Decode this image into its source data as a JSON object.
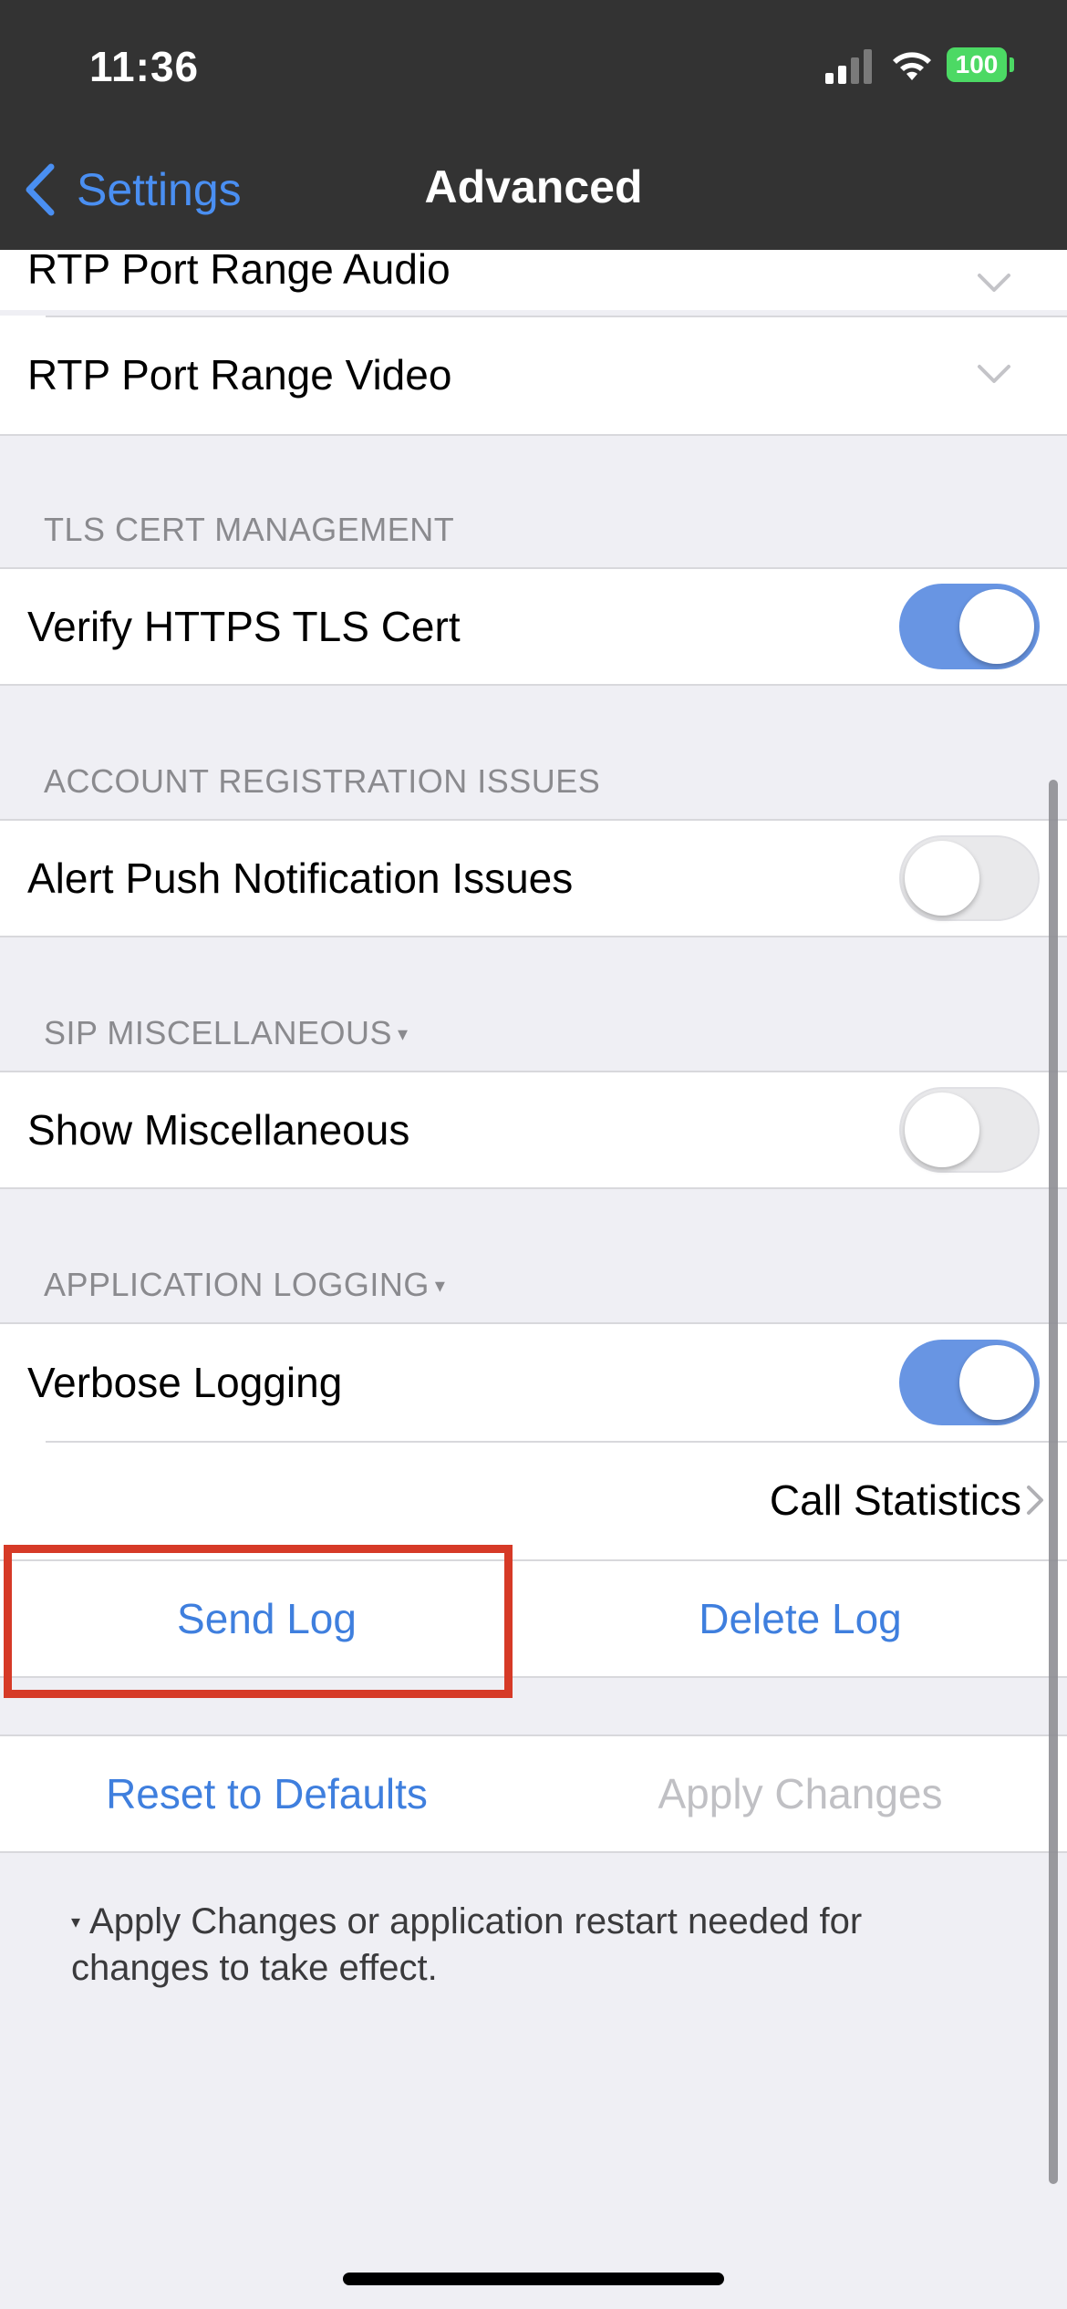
{
  "status_bar": {
    "time": "11:36",
    "battery": "100"
  },
  "nav": {
    "back_label": "Settings",
    "title": "Advanced"
  },
  "rows": {
    "rtp_audio": "RTP Port Range Audio",
    "rtp_video": "RTP Port Range Video",
    "verify_tls": "Verify HTTPS TLS Cert",
    "alert_push": "Alert Push Notification Issues",
    "show_misc": "Show Miscellaneous",
    "verbose_logging": "Verbose Logging",
    "call_statistics": "Call Statistics"
  },
  "sections": {
    "tls": "TLS CERT MANAGEMENT",
    "account": "ACCOUNT REGISTRATION ISSUES",
    "sip_misc": "SIP MISCELLANEOUS",
    "app_logging": "APPLICATION LOGGING",
    "marker": "▾"
  },
  "toggles": {
    "verify_tls": true,
    "alert_push": false,
    "show_misc": false,
    "verbose_logging": true
  },
  "actions": {
    "send_log": "Send Log",
    "delete_log": "Delete Log",
    "reset_defaults": "Reset to Defaults",
    "apply_changes": "Apply Changes"
  },
  "footer_note": "Apply Changes or application restart needed for changes to take effect.",
  "colors": {
    "accent": "#3f7fde",
    "toggle_on": "#6895e3",
    "highlight": "#d63a27",
    "bar": "#333333"
  }
}
